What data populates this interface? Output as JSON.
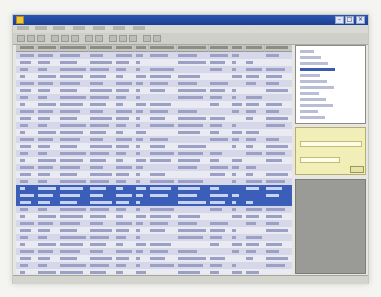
{
  "window": {
    "title": ""
  },
  "menu": [
    "",
    "",
    "",
    "",
    "",
    "",
    ""
  ],
  "status": {
    "left": "",
    "middle": ""
  },
  "colors": {
    "titlebar": "#1f47a3",
    "selection": "#3b5fb8",
    "row_even": "#d6d7e8",
    "row_odd": "#eaeaf2",
    "info_panel": "#f2eeb8"
  },
  "icons": [
    "minimize-icon",
    "maximize-icon",
    "close-icon"
  ]
}
